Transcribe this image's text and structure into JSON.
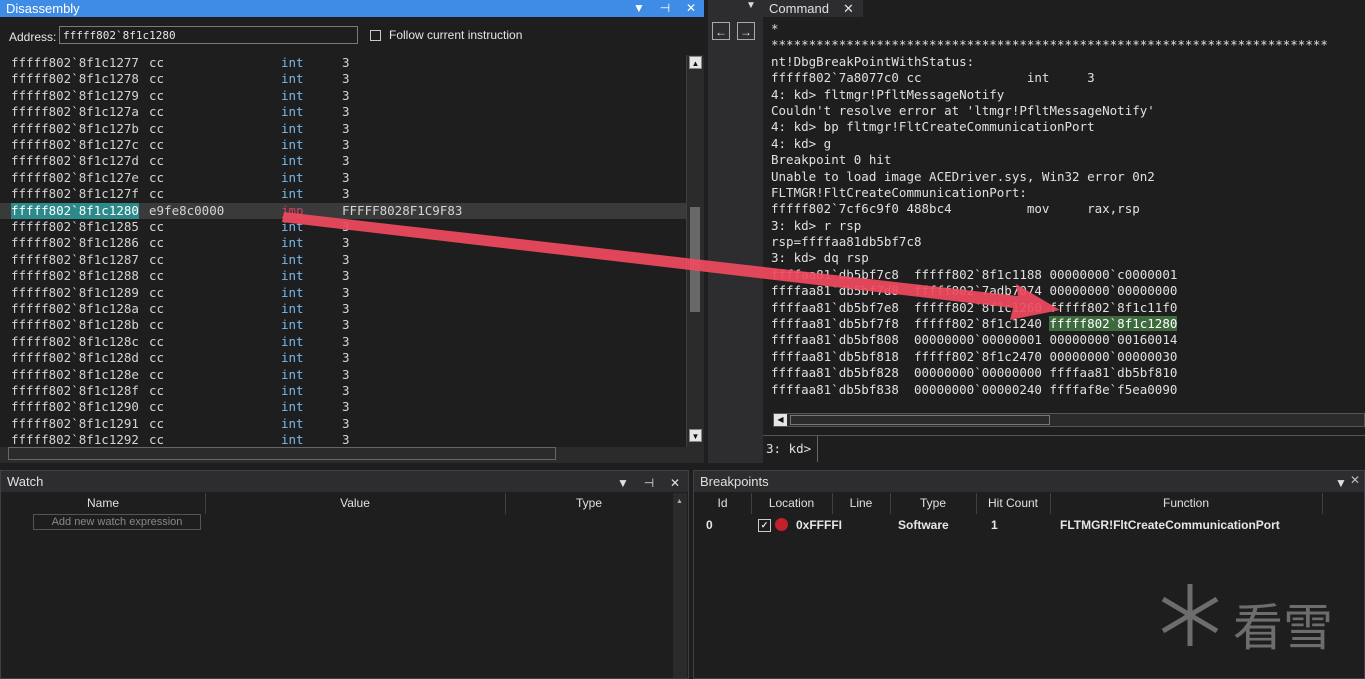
{
  "disassembly": {
    "title": "Disassembly",
    "address_label": "Address:",
    "address_value": "fffff802`8f1c1280",
    "follow_label": "Follow current instruction",
    "lines": [
      {
        "addr": "fffff802`8f1c1277",
        "bytes": "cc",
        "mn": "int",
        "op": "3"
      },
      {
        "addr": "fffff802`8f1c1278",
        "bytes": "cc",
        "mn": "int",
        "op": "3"
      },
      {
        "addr": "fffff802`8f1c1279",
        "bytes": "cc",
        "mn": "int",
        "op": "3"
      },
      {
        "addr": "fffff802`8f1c127a",
        "bytes": "cc",
        "mn": "int",
        "op": "3"
      },
      {
        "addr": "fffff802`8f1c127b",
        "bytes": "cc",
        "mn": "int",
        "op": "3"
      },
      {
        "addr": "fffff802`8f1c127c",
        "bytes": "cc",
        "mn": "int",
        "op": "3"
      },
      {
        "addr": "fffff802`8f1c127d",
        "bytes": "cc",
        "mn": "int",
        "op": "3"
      },
      {
        "addr": "fffff802`8f1c127e",
        "bytes": "cc",
        "mn": "int",
        "op": "3"
      },
      {
        "addr": "fffff802`8f1c127f",
        "bytes": "cc",
        "mn": "int",
        "op": "3"
      },
      {
        "addr": "fffff802`8f1c1280",
        "bytes": "e9fe8c0000",
        "mn": "jmp",
        "op": "FFFFF8028F1C9F83",
        "hl": true
      },
      {
        "addr": "fffff802`8f1c1285",
        "bytes": "cc",
        "mn": "int",
        "op": "3"
      },
      {
        "addr": "fffff802`8f1c1286",
        "bytes": "cc",
        "mn": "int",
        "op": "3"
      },
      {
        "addr": "fffff802`8f1c1287",
        "bytes": "cc",
        "mn": "int",
        "op": "3"
      },
      {
        "addr": "fffff802`8f1c1288",
        "bytes": "cc",
        "mn": "int",
        "op": "3"
      },
      {
        "addr": "fffff802`8f1c1289",
        "bytes": "cc",
        "mn": "int",
        "op": "3"
      },
      {
        "addr": "fffff802`8f1c128a",
        "bytes": "cc",
        "mn": "int",
        "op": "3"
      },
      {
        "addr": "fffff802`8f1c128b",
        "bytes": "cc",
        "mn": "int",
        "op": "3"
      },
      {
        "addr": "fffff802`8f1c128c",
        "bytes": "cc",
        "mn": "int",
        "op": "3"
      },
      {
        "addr": "fffff802`8f1c128d",
        "bytes": "cc",
        "mn": "int",
        "op": "3"
      },
      {
        "addr": "fffff802`8f1c128e",
        "bytes": "cc",
        "mn": "int",
        "op": "3"
      },
      {
        "addr": "fffff802`8f1c128f",
        "bytes": "cc",
        "mn": "int",
        "op": "3"
      },
      {
        "addr": "fffff802`8f1c1290",
        "bytes": "cc",
        "mn": "int",
        "op": "3"
      },
      {
        "addr": "fffff802`8f1c1291",
        "bytes": "cc",
        "mn": "int",
        "op": "3"
      },
      {
        "addr": "fffff802`8f1c1292",
        "bytes": "cc",
        "mn": "int",
        "op": "3"
      }
    ]
  },
  "command": {
    "title": "Command",
    "lines": [
      "*",
      "**************************************************************************",
      "nt!DbgBreakPointWithStatus:",
      "fffff802`7a8077c0 cc              int     3",
      "4: kd> fltmgr!PfltMessageNotify",
      "Couldn't resolve error at 'ltmgr!PfltMessageNotify'",
      "4: kd> bp fltmgr!FltCreateCommunicationPort",
      "4: kd> g",
      "Breakpoint 0 hit",
      "Unable to load image ACEDriver.sys, Win32 error 0n2",
      "FLTMGR!FltCreateCommunicationPort:",
      "fffff802`7cf6c9f0 488bc4          mov     rax,rsp",
      "3: kd> r rsp",
      "rsp=ffffaa81db5bf7c8",
      "3: kd> dq rsp",
      "ffffaa81`db5bf7c8  fffff802`8f1c1188 00000000`c0000001",
      "ffffaa81`db5bf7d8  fffff802`7adb7074 00000000`00000000",
      "ffffaa81`db5bf7e8  fffff802`8f1c1260 fffff802`8f1c11f0",
      "ffffaa81`db5bf7f8  fffff802`8f1c1240 ",
      "ffffaa81`db5bf808  00000000`00000001 00000000`00160014",
      "ffffaa81`db5bf818  fffff802`8f1c2470 00000000`00000030",
      "ffffaa81`db5bf828  00000000`00000000 ffffaa81`db5bf810",
      "ffffaa81`db5bf838  00000000`00000240 ffffaf8e`f5ea0090"
    ],
    "highlight_value": "fffff802`8f1c1280",
    "prompt": "3: kd>"
  },
  "watch": {
    "title": "Watch",
    "col_name": "Name",
    "col_value": "Value",
    "col_type": "Type",
    "placeholder": "Add new watch expression"
  },
  "breakpoints": {
    "title": "Breakpoints",
    "cols": {
      "id": "Id",
      "location": "Location",
      "line": "Line",
      "type": "Type",
      "hit": "Hit Count",
      "function": "Function"
    },
    "row": {
      "id": "0",
      "location": "0xFFFFI",
      "line": "",
      "type": "Software",
      "hit": "1",
      "function": "FLTMGR!FltCreateCommunicationPort"
    }
  },
  "watermark": "看雪",
  "colors": {
    "title_active": "#3e8ce6",
    "arrow": "#f04a5e",
    "highlight": "#2d8a8a"
  }
}
